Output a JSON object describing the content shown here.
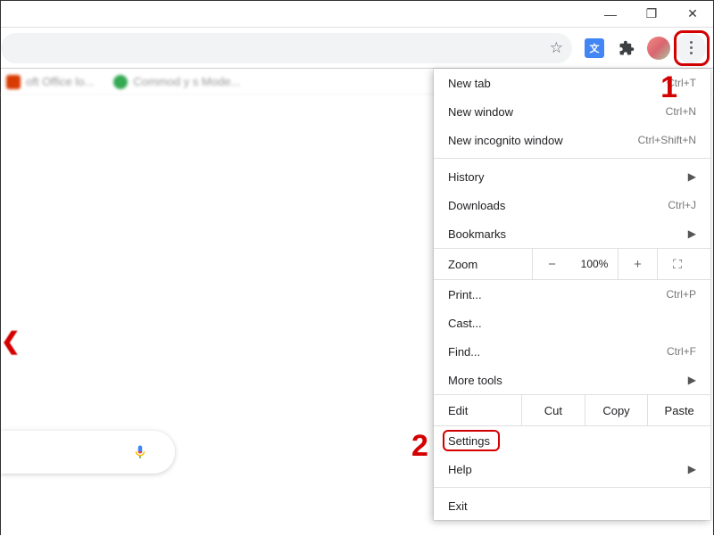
{
  "window": {
    "minimize": "—",
    "maximize": "❐",
    "close": "✕"
  },
  "toolbar": {
    "translate_badge": "G",
    "extensions_icon": "extensions"
  },
  "bookmarks": {
    "b1": "oft Office lo...",
    "b2": "Commod y s Mode..."
  },
  "menu": {
    "new_tab": {
      "label": "New tab",
      "shortcut": "Ctrl+T"
    },
    "new_window": {
      "label": "New window",
      "shortcut": "Ctrl+N"
    },
    "new_incognito": {
      "label": "New incognito window",
      "shortcut": "Ctrl+Shift+N"
    },
    "history": {
      "label": "History"
    },
    "downloads": {
      "label": "Downloads",
      "shortcut": "Ctrl+J"
    },
    "bookmarks": {
      "label": "Bookmarks"
    },
    "zoom": {
      "label": "Zoom",
      "value": "100%",
      "minus": "−",
      "plus": "+"
    },
    "print": {
      "label": "Print...",
      "shortcut": "Ctrl+P"
    },
    "cast": {
      "label": "Cast..."
    },
    "find": {
      "label": "Find...",
      "shortcut": "Ctrl+F"
    },
    "more_tools": {
      "label": "More tools"
    },
    "edit": {
      "label": "Edit",
      "cut": "Cut",
      "copy": "Copy",
      "paste": "Paste"
    },
    "settings": {
      "label": "Settings"
    },
    "help": {
      "label": "Help"
    },
    "exit": {
      "label": "Exit"
    }
  },
  "annotations": {
    "n1": "1",
    "n2": "2"
  }
}
